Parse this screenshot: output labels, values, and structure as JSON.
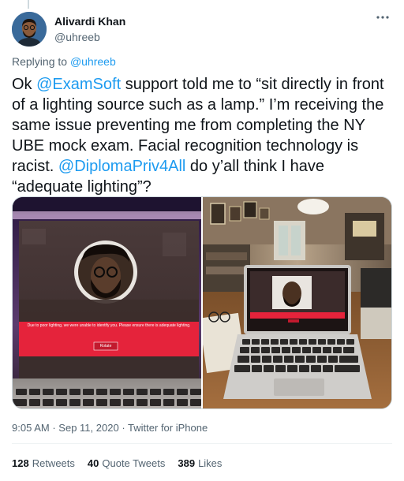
{
  "author": {
    "display_name": "Alivardi Khan",
    "handle": "@uhreeb"
  },
  "more_icon": "ellipsis-icon",
  "reply_context": {
    "prefix": "Replying to",
    "mention": "@uhreeb"
  },
  "tweet": {
    "t1": "Ok ",
    "m1": "@ExamSoft",
    "t2": " support told me to “sit directly in front of a lighting source such as a lamp.” I’m receiving the same issue preventing me from completing the NY UBE mock exam. Facial recognition technology is racist. ",
    "m2": "@DiplomaPriv4All",
    "t3": " do y’all think I have “adequate lighting”?"
  },
  "media": {
    "left_warning": "Due to poor lighting, we were unable to identify you. Please ensure there is adequate lighting.",
    "left_button": "Rotate"
  },
  "meta": {
    "time": "9:05 AM",
    "date": "Sep 11, 2020",
    "source": "Twitter for iPhone",
    "separator": "·"
  },
  "stats": {
    "retweets_count": "128",
    "retweets_label": "Retweets",
    "quotes_count": "40",
    "quotes_label": "Quote Tweets",
    "likes_count": "389",
    "likes_label": "Likes"
  },
  "colors": {
    "link": "#1d9bf0",
    "secondary_text": "#536471",
    "warning_red": "#e5233b"
  }
}
